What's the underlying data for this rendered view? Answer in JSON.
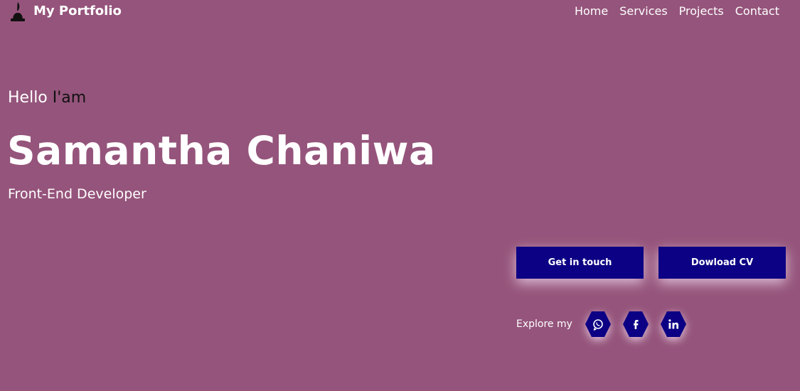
{
  "nav": {
    "logo_text": "My Portfolio",
    "links": [
      {
        "label": "Home"
      },
      {
        "label": "Services"
      },
      {
        "label": "Projects"
      },
      {
        "label": "Contact"
      }
    ]
  },
  "hero": {
    "greeting": "Hello",
    "greeting_accent": "I'am",
    "name": "Samantha Chaniwa",
    "role": "Front-End Developer"
  },
  "actions": {
    "contact_label": "Get in touch",
    "cv_label": "Dowload CV"
  },
  "social": {
    "label": "Explore my",
    "icons": [
      "whatsapp-icon",
      "facebook-icon",
      "linkedin-icon"
    ]
  },
  "colors": {
    "background": "#95547b",
    "button": "#0c0084",
    "text": "#ffffff",
    "accent_text": "#111111"
  }
}
